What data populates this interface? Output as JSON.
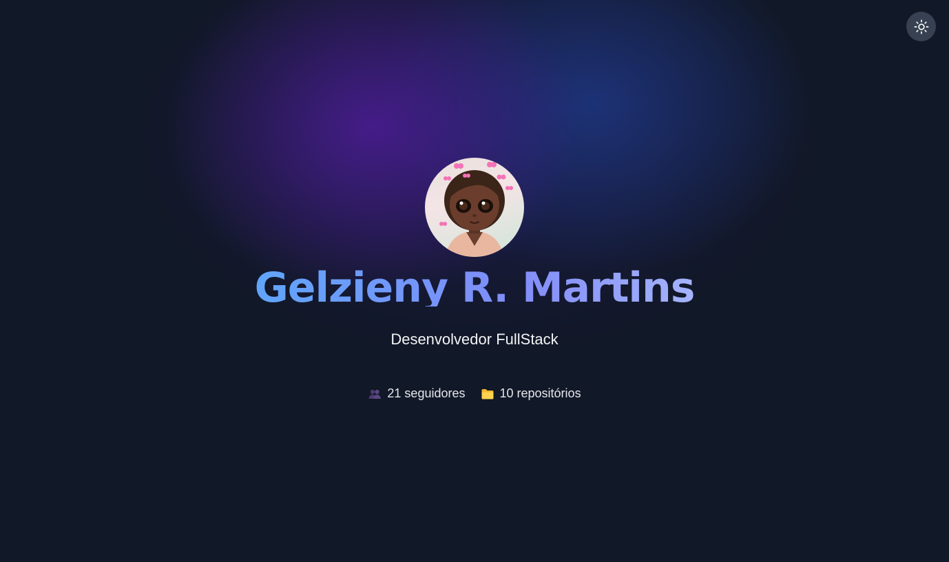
{
  "theme_toggle": {
    "icon": "sun-icon"
  },
  "profile": {
    "avatar_icon": "avatar-illustration",
    "name": "Gelzieny R. Martins",
    "role": "Desenvolvedor FullStack",
    "stats": {
      "followers": {
        "icon": "people-icon",
        "label": "21 seguidores"
      },
      "repos": {
        "icon": "folder-icon",
        "label": "10 repositórios"
      }
    }
  },
  "colors": {
    "background": "#111827",
    "toggle_bg": "#374151",
    "name_gradient_start": "#60a5fa",
    "name_gradient_end": "#a5b4fc"
  }
}
